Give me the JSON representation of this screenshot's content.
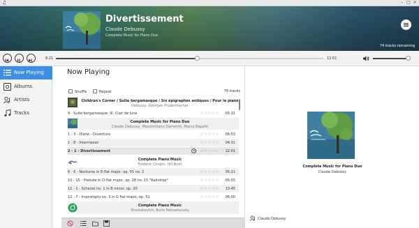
{
  "titlebar": {
    "app_icon": "♫"
  },
  "header": {
    "title": "Divertissement",
    "artist": "Claude Debussy",
    "album": "Complete Music for Piano Duo",
    "remaining": "74 tracks remaining"
  },
  "transport": {
    "elapsed": "6:21",
    "total": "12:01",
    "progress_fraction": 0.53,
    "volume_fraction": 0.93
  },
  "sidebar": {
    "items": [
      {
        "label": "Now Playing",
        "icon": "queue-icon",
        "active": true
      },
      {
        "label": "Albums",
        "icon": "album-icon",
        "active": false
      },
      {
        "label": "Artists",
        "icon": "artist-icon",
        "active": false
      },
      {
        "label": "Tracks",
        "icon": "music-note-icon",
        "active": false
      }
    ]
  },
  "main": {
    "title": "Now Playing",
    "shuffle_label": "Shuffle",
    "repeat_label": "Repeat",
    "track_count": "78 tracks",
    "groups": [
      {
        "title": "Children's Corner / Suite bergamasque / Six épigraphes antiques / Pour le piano",
        "subtitle": "Debussy, Georges Pludermacher"
      },
      {
        "title": "Complete Music for Piano Duo",
        "subtitle": "Claude Debussy, Massimiliano Damerini, Marco Rapetti"
      },
      {
        "title": "Complete Piano Music",
        "subtitle": "Frédéric Chopin, Idil Biret"
      },
      {
        "title": "Complete Piano Music",
        "subtitle": "Shostakovich; Boris Petrushansky"
      }
    ],
    "tracks": [
      {
        "name": "9 - Suite bergamasque: III. Clair de lune",
        "duration": "05:31"
      },
      {
        "name": "1 - 3 - Diane - Ouverture",
        "duration": "06:53"
      },
      {
        "name": "1 - 8 - Intermezzo",
        "duration": "04:31"
      },
      {
        "name": "2 - 1 - Divertissement",
        "duration": "12:01"
      },
      {
        "name": "6 - 6 - Nocturne in E-flat major, op. 55 no. 2",
        "duration": "05:21"
      },
      {
        "name": "10 - 15 - Prelude in D-flat major, op. 28 no. 15 \"Raindrop\"",
        "duration": "05:55"
      },
      {
        "name": "12 - 1 - Scherzo no. 1 in B minor, op. 20",
        "duration": "10:45"
      },
      {
        "name": "12 - 7 - Impromptu no. 3 in G flat major, op. 51",
        "duration": "06:00"
      }
    ],
    "stars": "☆☆☆☆☆"
  },
  "info": {
    "album": "Complete Music for Piano Duo",
    "artist": "Claude Debussy",
    "footer_artist": "Claude Debussy"
  },
  "colors": {
    "accent": "#3d8ee6"
  }
}
